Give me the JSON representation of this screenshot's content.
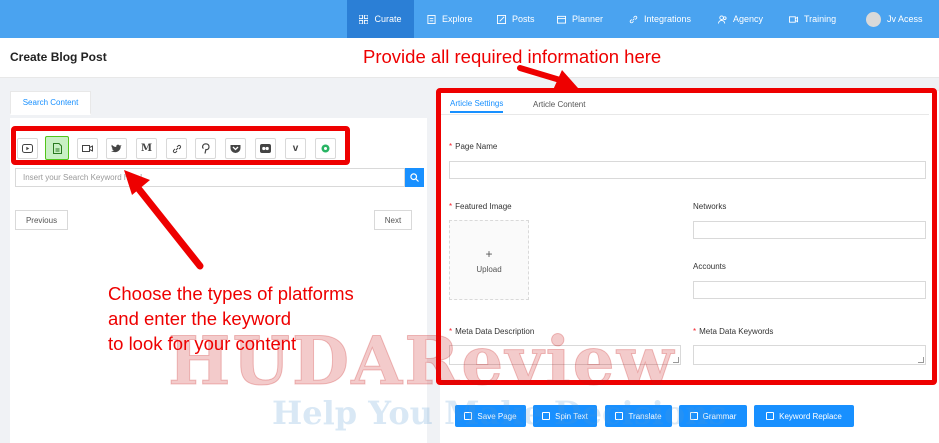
{
  "nav": {
    "items": [
      {
        "label": "Curate",
        "icon": "grid-icon"
      },
      {
        "label": "Explore",
        "icon": "document-icon"
      },
      {
        "label": "Posts",
        "icon": "edit-icon"
      },
      {
        "label": "Planner",
        "icon": "calendar-icon"
      },
      {
        "label": "Integrations",
        "icon": "link-icon"
      },
      {
        "label": "Agency",
        "icon": "users-icon"
      },
      {
        "label": "Training",
        "icon": "video-icon"
      }
    ],
    "user": "Jv Acess"
  },
  "page": {
    "title": "Create Blog Post"
  },
  "search": {
    "tab_label": "Search Content",
    "placeholder": "Insert your Search Keyword here!",
    "previous": "Previous",
    "next": "Next",
    "platforms": [
      "youtube-icon",
      "article-icon",
      "video-icon",
      "twitter-icon",
      "medium-icon",
      "link-icon",
      "pinterest-icon",
      "pocket-icon",
      "flickr-icon",
      "vimeo-icon",
      "giphy-icon"
    ],
    "active_platform": "article-icon"
  },
  "form": {
    "tabs": [
      "Article Settings",
      "Article Content"
    ],
    "page_name": "Page Name",
    "featured_image": "Featured Image",
    "upload": "Upload",
    "networks": "Networks",
    "accounts": "Accounts",
    "meta_description": "Meta Data Description",
    "meta_keywords": "Meta Data Keywords",
    "required_mark": "*"
  },
  "actions": [
    "Save Page",
    "Spin Text",
    "Translate",
    "Grammar",
    "Keyword Replace"
  ],
  "annotations": {
    "top": "Provide all required information here",
    "left_1": "Choose the types of platforms",
    "left_2": "and enter the keyword",
    "left_3": "to look for your content"
  },
  "watermark": {
    "main": "HUDAReview",
    "sub": "Help You Make Decisions"
  },
  "colors": {
    "nav": "#4aa3f0",
    "nav_active": "#2b7fd6",
    "primary": "#1890ff",
    "annotation": "#ee0000",
    "platform_active": "#c9f0c4"
  }
}
